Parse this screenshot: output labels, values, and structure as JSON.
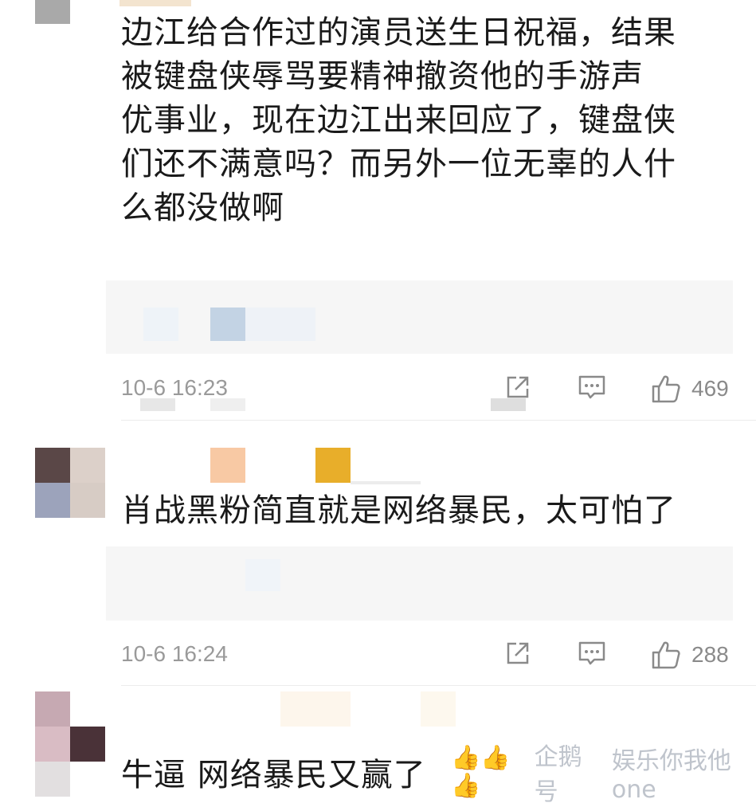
{
  "comments": [
    {
      "text": "边江给合作过的演员送生日祝福，结果\n被键盘侠辱骂要精神撤资他的手游声\n优事业，现在边江出来回应了，键盘侠\n们还不满意吗？而另外一位无辜的人什\n么都没做啊",
      "time": "10-6 16:23",
      "likes": "469"
    },
    {
      "text": "肖战黑粉简直就是网络暴民，太可怕了",
      "time": "10-6 16:24",
      "likes": "288"
    },
    {
      "text": "牛逼 网络暴民又赢了"
    }
  ],
  "watermark": {
    "emoji": "👍👍👍",
    "brand": "企鹅号",
    "account": "娱乐你我他one"
  },
  "icons": {
    "share": "share-icon",
    "reply": "comment-icon",
    "like": "thumbs-up-icon"
  }
}
